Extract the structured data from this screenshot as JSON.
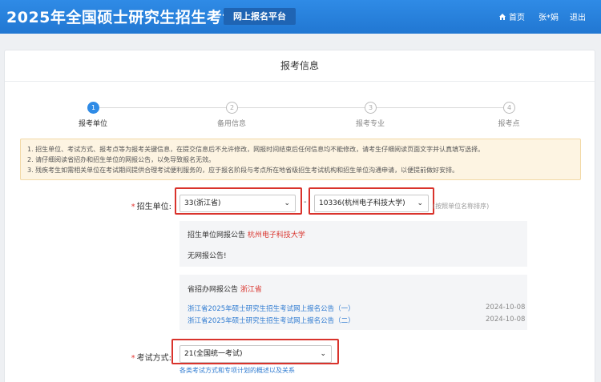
{
  "header": {
    "title": "2025年全国硕士研究生招生考试",
    "platform": "网上报名平台",
    "nav": {
      "home": "首页",
      "user": "张*娟",
      "logout": "退出"
    }
  },
  "page": {
    "card_title": "报考信息"
  },
  "steps": [
    {
      "num": "1",
      "label": "报考单位",
      "active": true
    },
    {
      "num": "2",
      "label": "备用信息",
      "active": false
    },
    {
      "num": "3",
      "label": "报考专业",
      "active": false
    },
    {
      "num": "4",
      "label": "报考点",
      "active": false
    }
  ],
  "notice": [
    "1. 招生单位、考试方式、报考点等为报考关键信息，在提交信息后不允许修改，网报时间结束后任何信息均不能修改，请考生仔细阅读页面文字并认真填写选择。",
    "2. 请仔细阅读省招办和招生单位的网报公告，以免导致报名无效。",
    "3. 残疾考生如需相关单位在考试期间提供合理考试便利服务的，应于报名阶段与考点所在地省级招生考试机构和招生单位沟通申请，以便提前做好安排。"
  ],
  "form": {
    "unit_label": "招生单位:",
    "province_value": "33(浙江省)",
    "unit_value": "10336(杭州电子科技大学)",
    "separator": "-",
    "unit_hint": "(按照单位名称排序)",
    "exam_label": "考试方式:",
    "exam_value": "21(全国统一考试)",
    "exam_link": "各类考试方式和专项计划的概述以及关系"
  },
  "unit_panel": {
    "head": "招生单位网报公告",
    "unit_name": "杭州电子科技大学",
    "empty_text": "无网报公告!"
  },
  "province_panel": {
    "head": "省招办网报公告",
    "province_name": "浙江省",
    "announcements": [
      {
        "title": "浙江省2025年硕士研究生招生考试网上报名公告（一）",
        "date": "2024-10-08"
      },
      {
        "title": "浙江省2025年硕士研究生招生考试网上报名公告（二）",
        "date": "2024-10-08"
      }
    ]
  },
  "colors": {
    "header_blue": "#2f8be6",
    "highlight_red": "#d9332c",
    "link_blue": "#2f7bd1"
  }
}
